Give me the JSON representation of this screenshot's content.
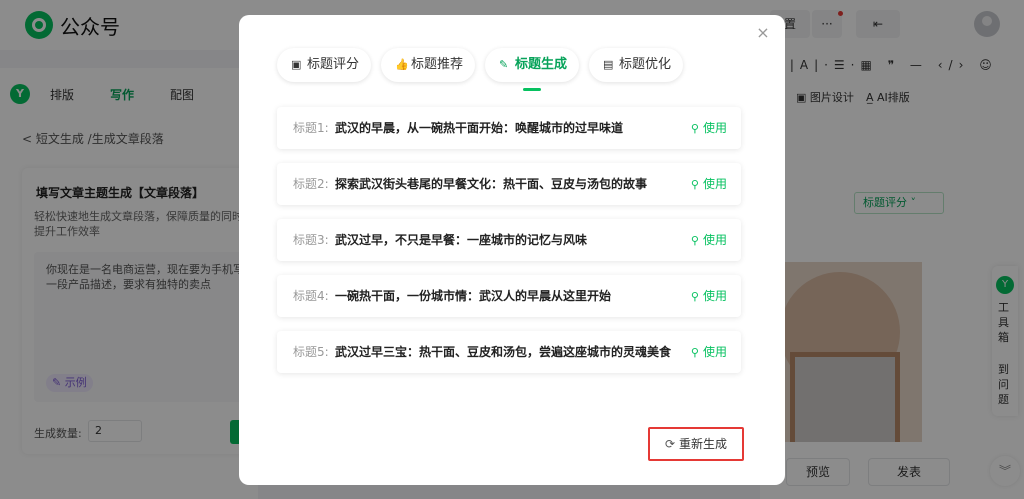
{
  "app": {
    "name": "公众号",
    "top_btn_1": "置",
    "top_btn_2": "···"
  },
  "left_panel": {
    "tabs": [
      "排版",
      "写作",
      "配图"
    ],
    "breadcrumb": "< 短文生成 /生成文章段落",
    "card_title": "填写文章主题生成【文章段落】",
    "card_desc": "轻松快速地生成文章段落，保障质量的同时提升工作效率",
    "prompt_text": "你现在是一名电商运营，现在要为手机写一段产品描述，要求有独特的卖点",
    "example_label": "示例",
    "count_label": "生成数量:",
    "count_value": "2"
  },
  "editor": {
    "toolbar": "·|A|·☰·▦ ❞ — ‹/› ☺",
    "image_design": "图片设计",
    "ai_layout": "AI排版",
    "score_btn": "标题评分 ˅",
    "preview_label": "预览",
    "publish_label": "发表",
    "toolbox_text": "工具箱",
    "toolbox_text2": "到问题"
  },
  "modal": {
    "close": "×",
    "tabs": [
      {
        "label": "标题评分",
        "icon": "▣"
      },
      {
        "label": "标题推荐",
        "icon": "👍"
      },
      {
        "label": "标题生成",
        "icon": "✎"
      },
      {
        "label": "标题优化",
        "icon": "▤"
      }
    ],
    "active_tab": 2,
    "titles": [
      {
        "prefix": "标题1:",
        "text": "武汉的早晨，从一碗热干面开始：唤醒城市的过早味道",
        "use": "使用"
      },
      {
        "prefix": "标题2:",
        "text": "探索武汉街头巷尾的早餐文化：热干面、豆皮与汤包的故事",
        "use": "使用"
      },
      {
        "prefix": "标题3:",
        "text": "武汉过早，不只是早餐：一座城市的记忆与风味",
        "use": "使用"
      },
      {
        "prefix": "标题4:",
        "text": "一碗热干面，一份城市情：武汉人的早晨从这里开始",
        "use": "使用"
      },
      {
        "prefix": "标题5:",
        "text": "武汉过早三宝：热干面、豆皮和汤包，尝遍这座城市的灵魂美食",
        "use": "使用"
      }
    ],
    "regenerate_label": "重新生成"
  },
  "colors": {
    "accent": "#07c160",
    "highlight_box": "#e53935"
  }
}
